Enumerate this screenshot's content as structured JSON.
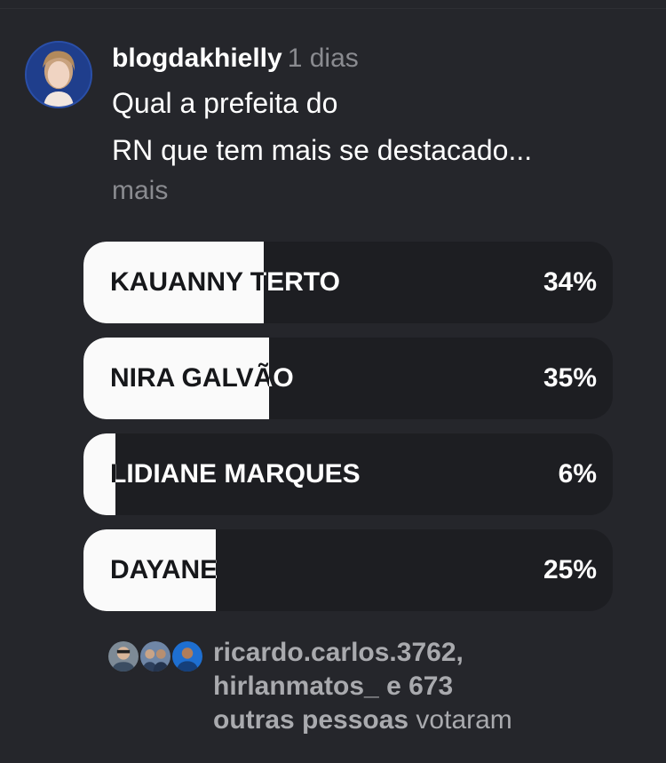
{
  "post": {
    "username": "blogdakhielly",
    "time": "1 dias",
    "caption_line1": "Qual a prefeita do",
    "caption_line2": "RN que tem mais se destacado...",
    "more": "mais"
  },
  "poll": {
    "options": [
      {
        "label": "KAUANNY TERTO",
        "percent": "34%",
        "fraction": 0.34
      },
      {
        "label": "NIRA GALVÃO",
        "percent": "35%",
        "fraction": 0.35
      },
      {
        "label": "LIDIANE MARQUES",
        "percent": "6%",
        "fraction": 0.06
      },
      {
        "label": "DAYANE",
        "percent": "25%",
        "fraction": 0.25
      }
    ]
  },
  "voters": {
    "name1": "ricardo.carlos.3762,",
    "name2": "hirlanmatos_",
    "connector": " e ",
    "count": "673",
    "others": "outras pessoas",
    "voted": " votaram"
  },
  "colors": {
    "background": "#25262b",
    "option_track": "#1d1e22",
    "option_fill": "#fafafa",
    "muted_text": "#8a8b90"
  }
}
